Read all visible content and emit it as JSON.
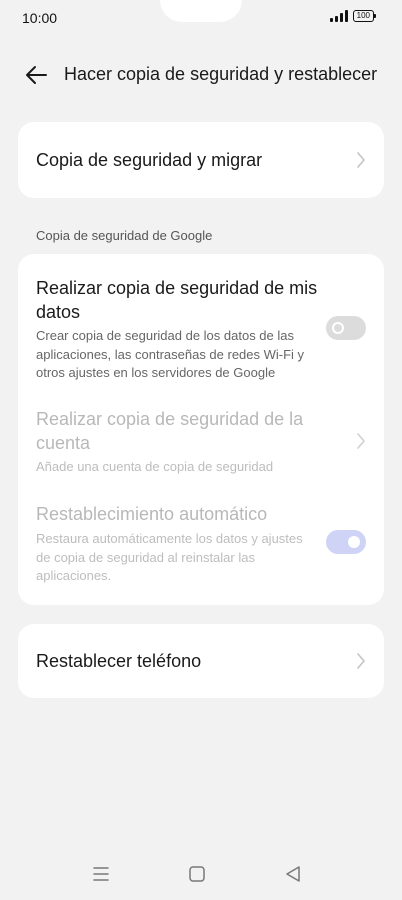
{
  "status_bar": {
    "time": "10:00",
    "battery": "100"
  },
  "header": {
    "title": "Hacer copia de seguridad y restablecer"
  },
  "backup_migrate": {
    "label": "Copia de seguridad y migrar"
  },
  "google_section": {
    "label": "Copia de seguridad de Google",
    "items": [
      {
        "title": "Realizar copia de seguridad de mis datos",
        "description": "Crear copia de seguridad de los datos de las aplicaciones, las contraseñas de redes Wi-Fi y otros ajustes en los servidores de Google",
        "toggle": "off"
      },
      {
        "title": "Realizar copia de seguridad de la cuenta",
        "description": "Añade una cuenta de copia de seguridad",
        "enabled": false
      },
      {
        "title": "Restablecimiento automático",
        "description": "Restaura automáticamente los datos y ajustes de copia de seguridad al reinstalar las aplicaciones.",
        "toggle": "on",
        "enabled": false
      }
    ]
  },
  "reset_phone": {
    "label": "Restablecer teléfono"
  },
  "colors": {
    "background": "#f2f2f2",
    "card": "#ffffff",
    "disabled_text": "#b8b8b8",
    "toggle_on_disabled": "#cfd4f6"
  },
  "icons": {
    "back": "arrow-left-icon",
    "chevron": "chevron-right-icon",
    "nav_menu": "menu-icon",
    "nav_home": "home-square-icon",
    "nav_back": "back-triangle-icon"
  }
}
